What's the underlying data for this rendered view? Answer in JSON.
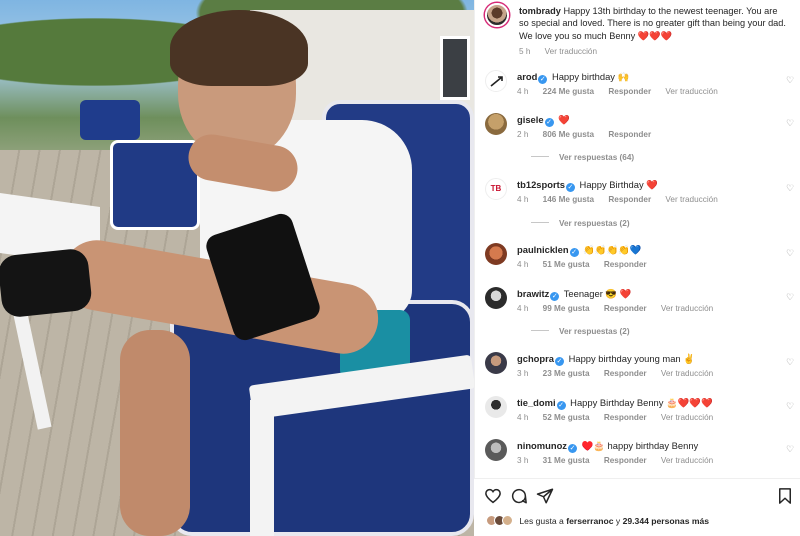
{
  "post": {
    "author": "tombrady",
    "caption": "Happy 13th birthday to the newest teenager. You are so special and loved. There is no greater gift than being your dad. We love you so much Benny",
    "caption_emoji": "❤️❤️❤️",
    "time": "5 h",
    "translate": "Ver traducción"
  },
  "comments": [
    {
      "user": "arod",
      "verified": true,
      "text": "Happy birthday 🙌",
      "time": "4 h",
      "likes": "224 Me gusta",
      "reply": "Responder",
      "translate": "Ver traducción",
      "avatar_color": "#ffffff",
      "avatar_glyph": "🏹"
    },
    {
      "user": "gisele",
      "verified": true,
      "text": "❤️",
      "time": "2 h",
      "likes": "806 Me gusta",
      "reply": "Responder",
      "translate": "",
      "avatar_color": "#b08b57",
      "avatar_glyph": "",
      "replies_label": "Ver respuestas (64)"
    },
    {
      "user": "tb12sports",
      "verified": true,
      "text": "Happy Birthday ❤️",
      "time": "4 h",
      "likes": "146 Me gusta",
      "reply": "Responder",
      "translate": "Ver traducción",
      "avatar_color": "#ffffff",
      "avatar_glyph": "TB",
      "replies_label": "Ver respuestas (2)"
    },
    {
      "user": "paulnicklen",
      "verified": true,
      "text": "👏👏👏👏💙",
      "time": "4 h",
      "likes": "51 Me gusta",
      "reply": "Responder",
      "translate": "",
      "avatar_color": "#a9553a",
      "avatar_glyph": ""
    },
    {
      "user": "brawitz",
      "verified": true,
      "text": "Teenager 😎 ❤️",
      "time": "4 h",
      "likes": "99 Me gusta",
      "reply": "Responder",
      "translate": "Ver traducción",
      "avatar_color": "#2b2b2b",
      "avatar_glyph": "",
      "replies_label": "Ver respuestas (2)"
    },
    {
      "user": "gchopra",
      "verified": true,
      "text": "Happy birthday young man ✌️",
      "time": "3 h",
      "likes": "23 Me gusta",
      "reply": "Responder",
      "translate": "Ver traducción",
      "avatar_color": "#4a4a5a",
      "avatar_glyph": ""
    },
    {
      "user": "tie_domi",
      "verified": true,
      "text": "Happy Birthday Benny 🎂❤️❤️❤️",
      "time": "4 h",
      "likes": "52 Me gusta",
      "reply": "Responder",
      "translate": "Ver traducción",
      "avatar_color": "#e9e9e9",
      "avatar_glyph": ""
    },
    {
      "user": "ninomunoz",
      "verified": true,
      "text": "♥️🎂 happy birthday Benny",
      "time": "3 h",
      "likes": "31 Me gusta",
      "reply": "Responder",
      "translate": "Ver traducción",
      "avatar_color": "#6d6d6d",
      "avatar_glyph": ""
    }
  ],
  "likes_summary": {
    "prefix": "Les gusta a",
    "user": "ferserranoc",
    "middle": "y",
    "count": "29.344 personas más"
  },
  "icons": {
    "like": "heart-outline-icon",
    "comment": "comment-bubble-icon",
    "share": "paper-plane-icon",
    "save": "bookmark-icon"
  },
  "colors": {
    "verified": "#3897f0",
    "meta": "#8e8e8e",
    "text": "#262626"
  }
}
